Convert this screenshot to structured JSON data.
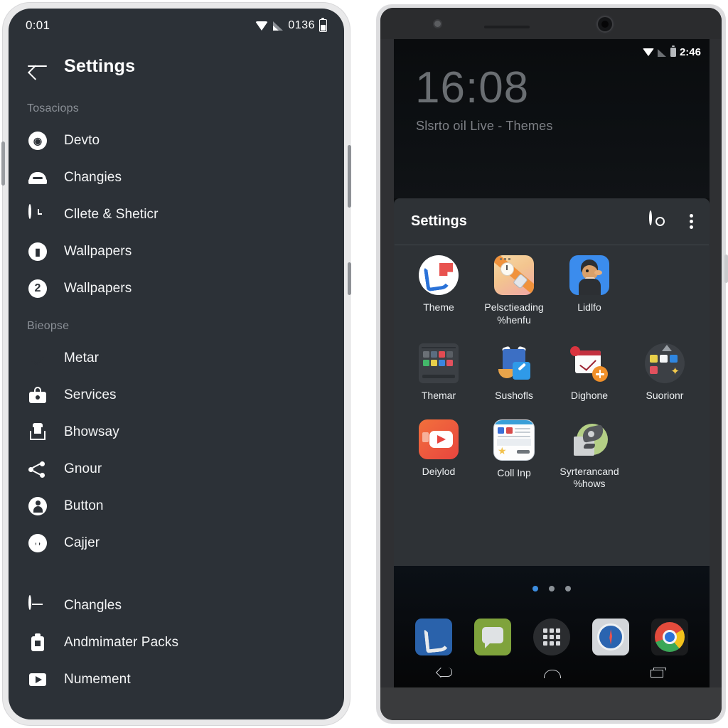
{
  "left_phone": {
    "status_bar": {
      "time": "0:01",
      "battery_text": "0136",
      "icons": [
        "wifi-icon",
        "signal-icon",
        "battery-icon"
      ]
    },
    "app_bar": {
      "back_icon": "back-arrow-icon",
      "title": "Settings"
    },
    "sections": [
      {
        "label": "Tosaciops",
        "items": [
          {
            "label": "Devto",
            "icon": "camera-circle-icon"
          },
          {
            "label": "Changies",
            "icon": "bed-icon"
          },
          {
            "label": "Cllete & Sheticr",
            "icon": "clock-icon"
          },
          {
            "label": "Wallpapers",
            "icon": "chat-circle-icon"
          },
          {
            "label": "Wallpapers",
            "icon": "number-two-icon"
          }
        ]
      },
      {
        "label": "Bieopse",
        "items": [
          {
            "label": "Metar",
            "icon": "mail-icon"
          },
          {
            "label": "Services",
            "icon": "bag-icon"
          },
          {
            "label": "Bhowsay",
            "icon": "gift-box-icon"
          },
          {
            "label": "Gnour",
            "icon": "share-nodes-icon"
          },
          {
            "label": "Button",
            "icon": "person-circle-icon"
          },
          {
            "label": "Cajjer",
            "icon": "pin-circle-icon"
          }
        ]
      },
      {
        "label": "",
        "items": [
          {
            "label": "Changles",
            "icon": "minus-circle-icon"
          },
          {
            "label": "Andmimater Packs",
            "icon": "badge-icon"
          },
          {
            "label": "Numement",
            "icon": "play-square-icon"
          }
        ]
      }
    ]
  },
  "right_phone": {
    "status_bar": {
      "time": "2:46",
      "icons": [
        "wifi-icon",
        "signal-icon",
        "battery-icon"
      ]
    },
    "lock_screen": {
      "clock": "16:08",
      "subtitle": "Slsrto oil Live - Themes"
    },
    "panel": {
      "title": "Settings",
      "settings_icon": "flower-gear-icon",
      "overflow_icon": "kebab-menu-icon"
    },
    "app_grid": {
      "rows": [
        [
          {
            "label": "Theme",
            "icon": "phone-flag-icon"
          },
          {
            "label": "Pelsctieading %henfu",
            "icon": "watch-clock-icon"
          },
          {
            "label": "Lidlfo",
            "icon": "person-avatar-icon"
          }
        ],
        [
          {
            "label": "Themar",
            "icon": "palette-swatch-icon"
          },
          {
            "label": "Sushofls",
            "icon": "backpack-pencil-icon"
          },
          {
            "label": "Dighone",
            "icon": "calendar-add-icon"
          },
          {
            "label": "Suorionr",
            "icon": "color-picker-icon"
          }
        ],
        [
          {
            "label": "Deiylod",
            "icon": "video-play-icon"
          },
          {
            "label": "Coll Inp",
            "icon": "document-star-icon"
          },
          {
            "label": "Syrterancand %hows",
            "icon": "tool-green-icon"
          }
        ]
      ]
    },
    "home": {
      "page_dots": 3,
      "active_dot": 0,
      "dock": [
        {
          "icon": "phone-dock-icon"
        },
        {
          "icon": "messages-dock-icon"
        },
        {
          "icon": "app-drawer-icon"
        },
        {
          "icon": "safari-dock-icon"
        },
        {
          "icon": "chrome-dock-icon"
        }
      ],
      "nav": [
        {
          "icon": "nav-back-icon"
        },
        {
          "icon": "nav-home-icon"
        },
        {
          "icon": "nav-recents-icon"
        }
      ]
    }
  },
  "colors": {
    "left_screen_bg": "#2c3137",
    "panel_bg": "#2e3236",
    "accent_dot": "#3d8ee0",
    "page_bg": "#ffffff"
  }
}
